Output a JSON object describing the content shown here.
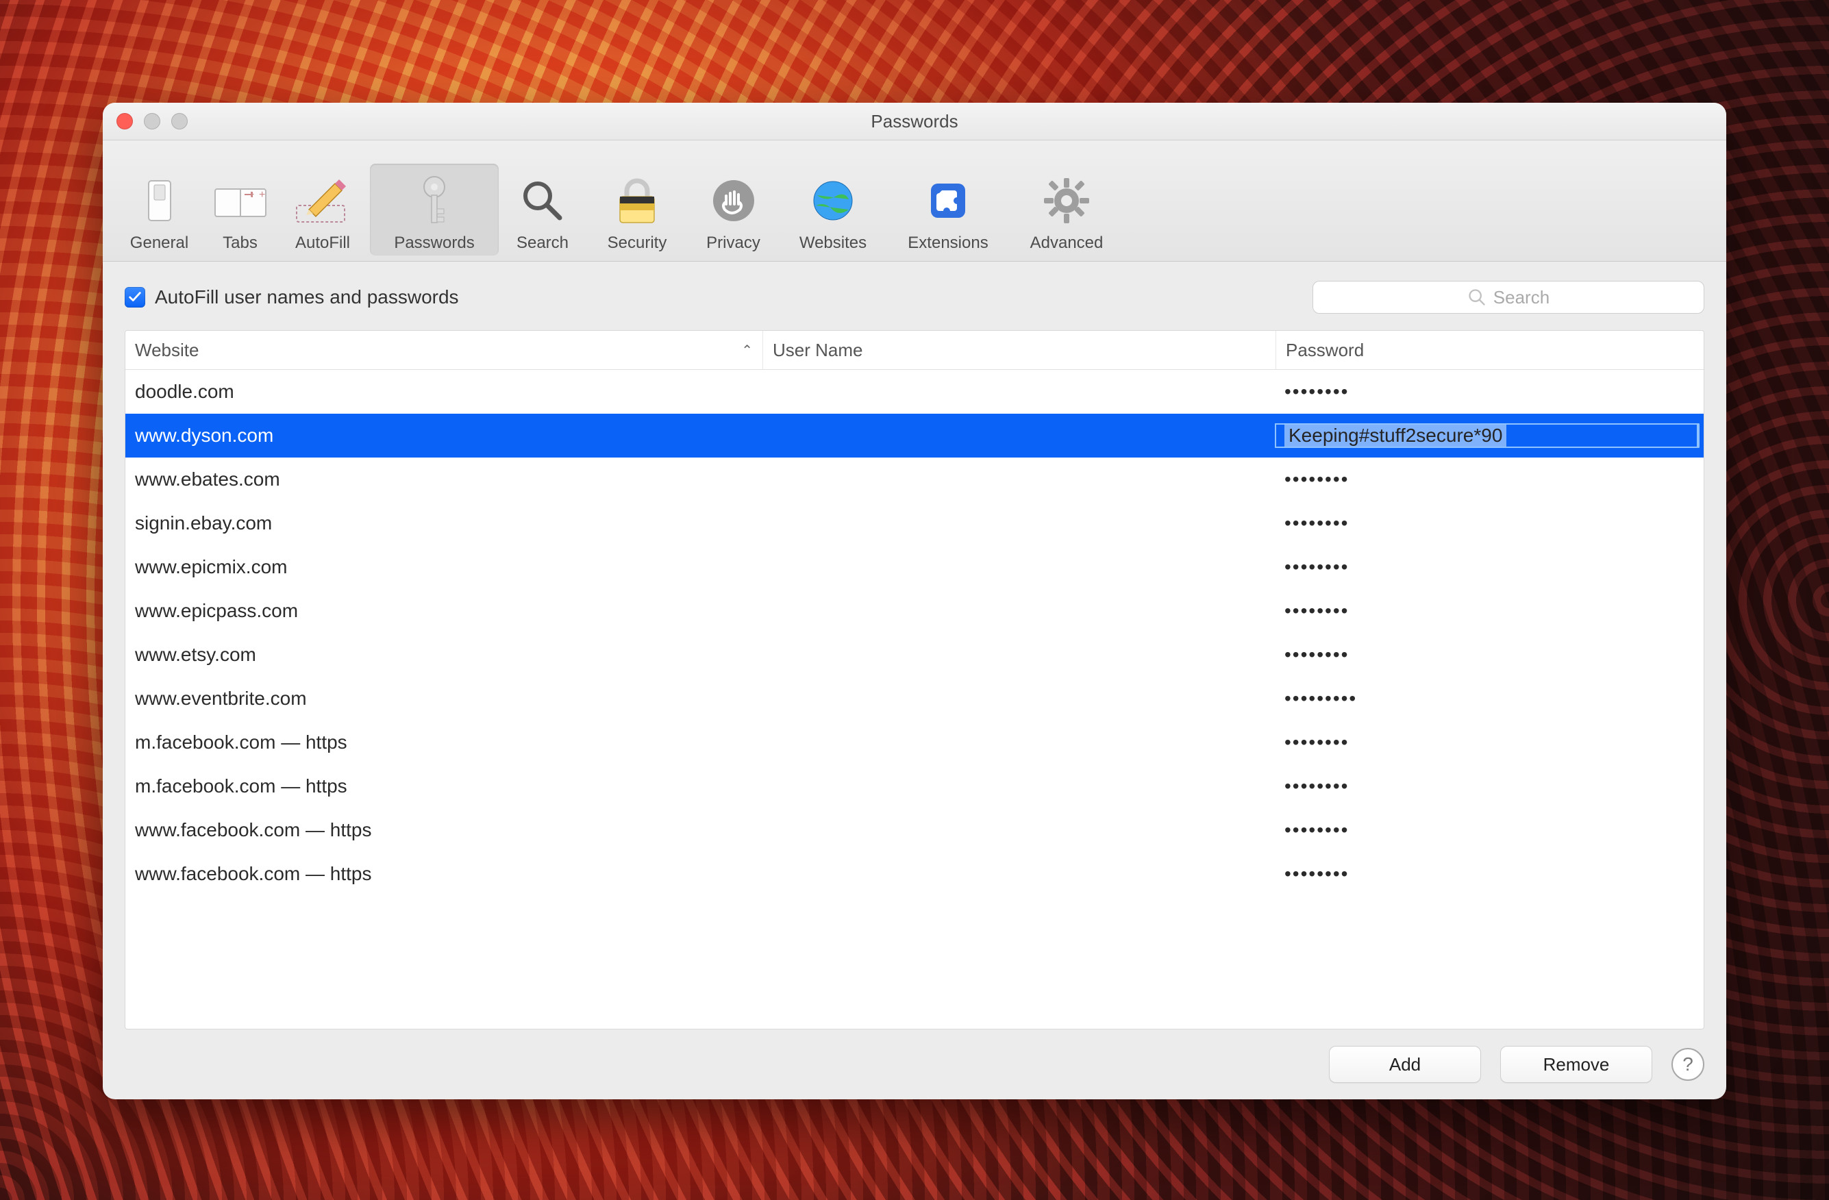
{
  "window": {
    "title": "Passwords"
  },
  "toolbar": [
    {
      "id": "general",
      "label": "General"
    },
    {
      "id": "tabs",
      "label": "Tabs"
    },
    {
      "id": "autofill",
      "label": "AutoFill"
    },
    {
      "id": "passwords",
      "label": "Passwords",
      "selected": true
    },
    {
      "id": "search",
      "label": "Search"
    },
    {
      "id": "security",
      "label": "Security"
    },
    {
      "id": "privacy",
      "label": "Privacy"
    },
    {
      "id": "websites",
      "label": "Websites"
    },
    {
      "id": "extensions",
      "label": "Extensions"
    },
    {
      "id": "advanced",
      "label": "Advanced"
    }
  ],
  "autofill_checkbox": {
    "checked": true,
    "label": "AutoFill user names and passwords"
  },
  "search": {
    "placeholder": "Search",
    "value": ""
  },
  "table": {
    "columns": {
      "website": "Website",
      "username": "User Name",
      "password": "Password"
    },
    "sort_column": "website",
    "sort_dir": "asc",
    "rows": [
      {
        "website": "doodle.com",
        "username": "",
        "password_masked": "••••••••"
      },
      {
        "website": "www.dyson.com",
        "username": "",
        "password_visible": "Keeping#stuff2secure*90",
        "selected": true
      },
      {
        "website": "www.ebates.com",
        "username": "",
        "password_masked": "••••••••"
      },
      {
        "website": "signin.ebay.com",
        "username": "",
        "password_masked": "••••••••"
      },
      {
        "website": "www.epicmix.com",
        "username": "",
        "password_masked": "••••••••"
      },
      {
        "website": "www.epicpass.com",
        "username": "",
        "password_masked": "••••••••"
      },
      {
        "website": "www.etsy.com",
        "username": "",
        "password_masked": "••••••••"
      },
      {
        "website": "www.eventbrite.com",
        "username": "",
        "password_masked": "•••••••••"
      },
      {
        "website": "m.facebook.com — https",
        "username": "",
        "password_masked": "••••••••"
      },
      {
        "website": "m.facebook.com — https",
        "username": "",
        "password_masked": "••••••••"
      },
      {
        "website": "www.facebook.com — https",
        "username": "",
        "password_masked": "••••••••"
      },
      {
        "website": "www.facebook.com — https",
        "username": "",
        "password_masked": "••••••••"
      }
    ]
  },
  "footer": {
    "add_label": "Add",
    "remove_label": "Remove",
    "help_label": "?"
  },
  "colors": {
    "selection": "#0a63f6",
    "edit_highlight": "#7fb2fb"
  }
}
